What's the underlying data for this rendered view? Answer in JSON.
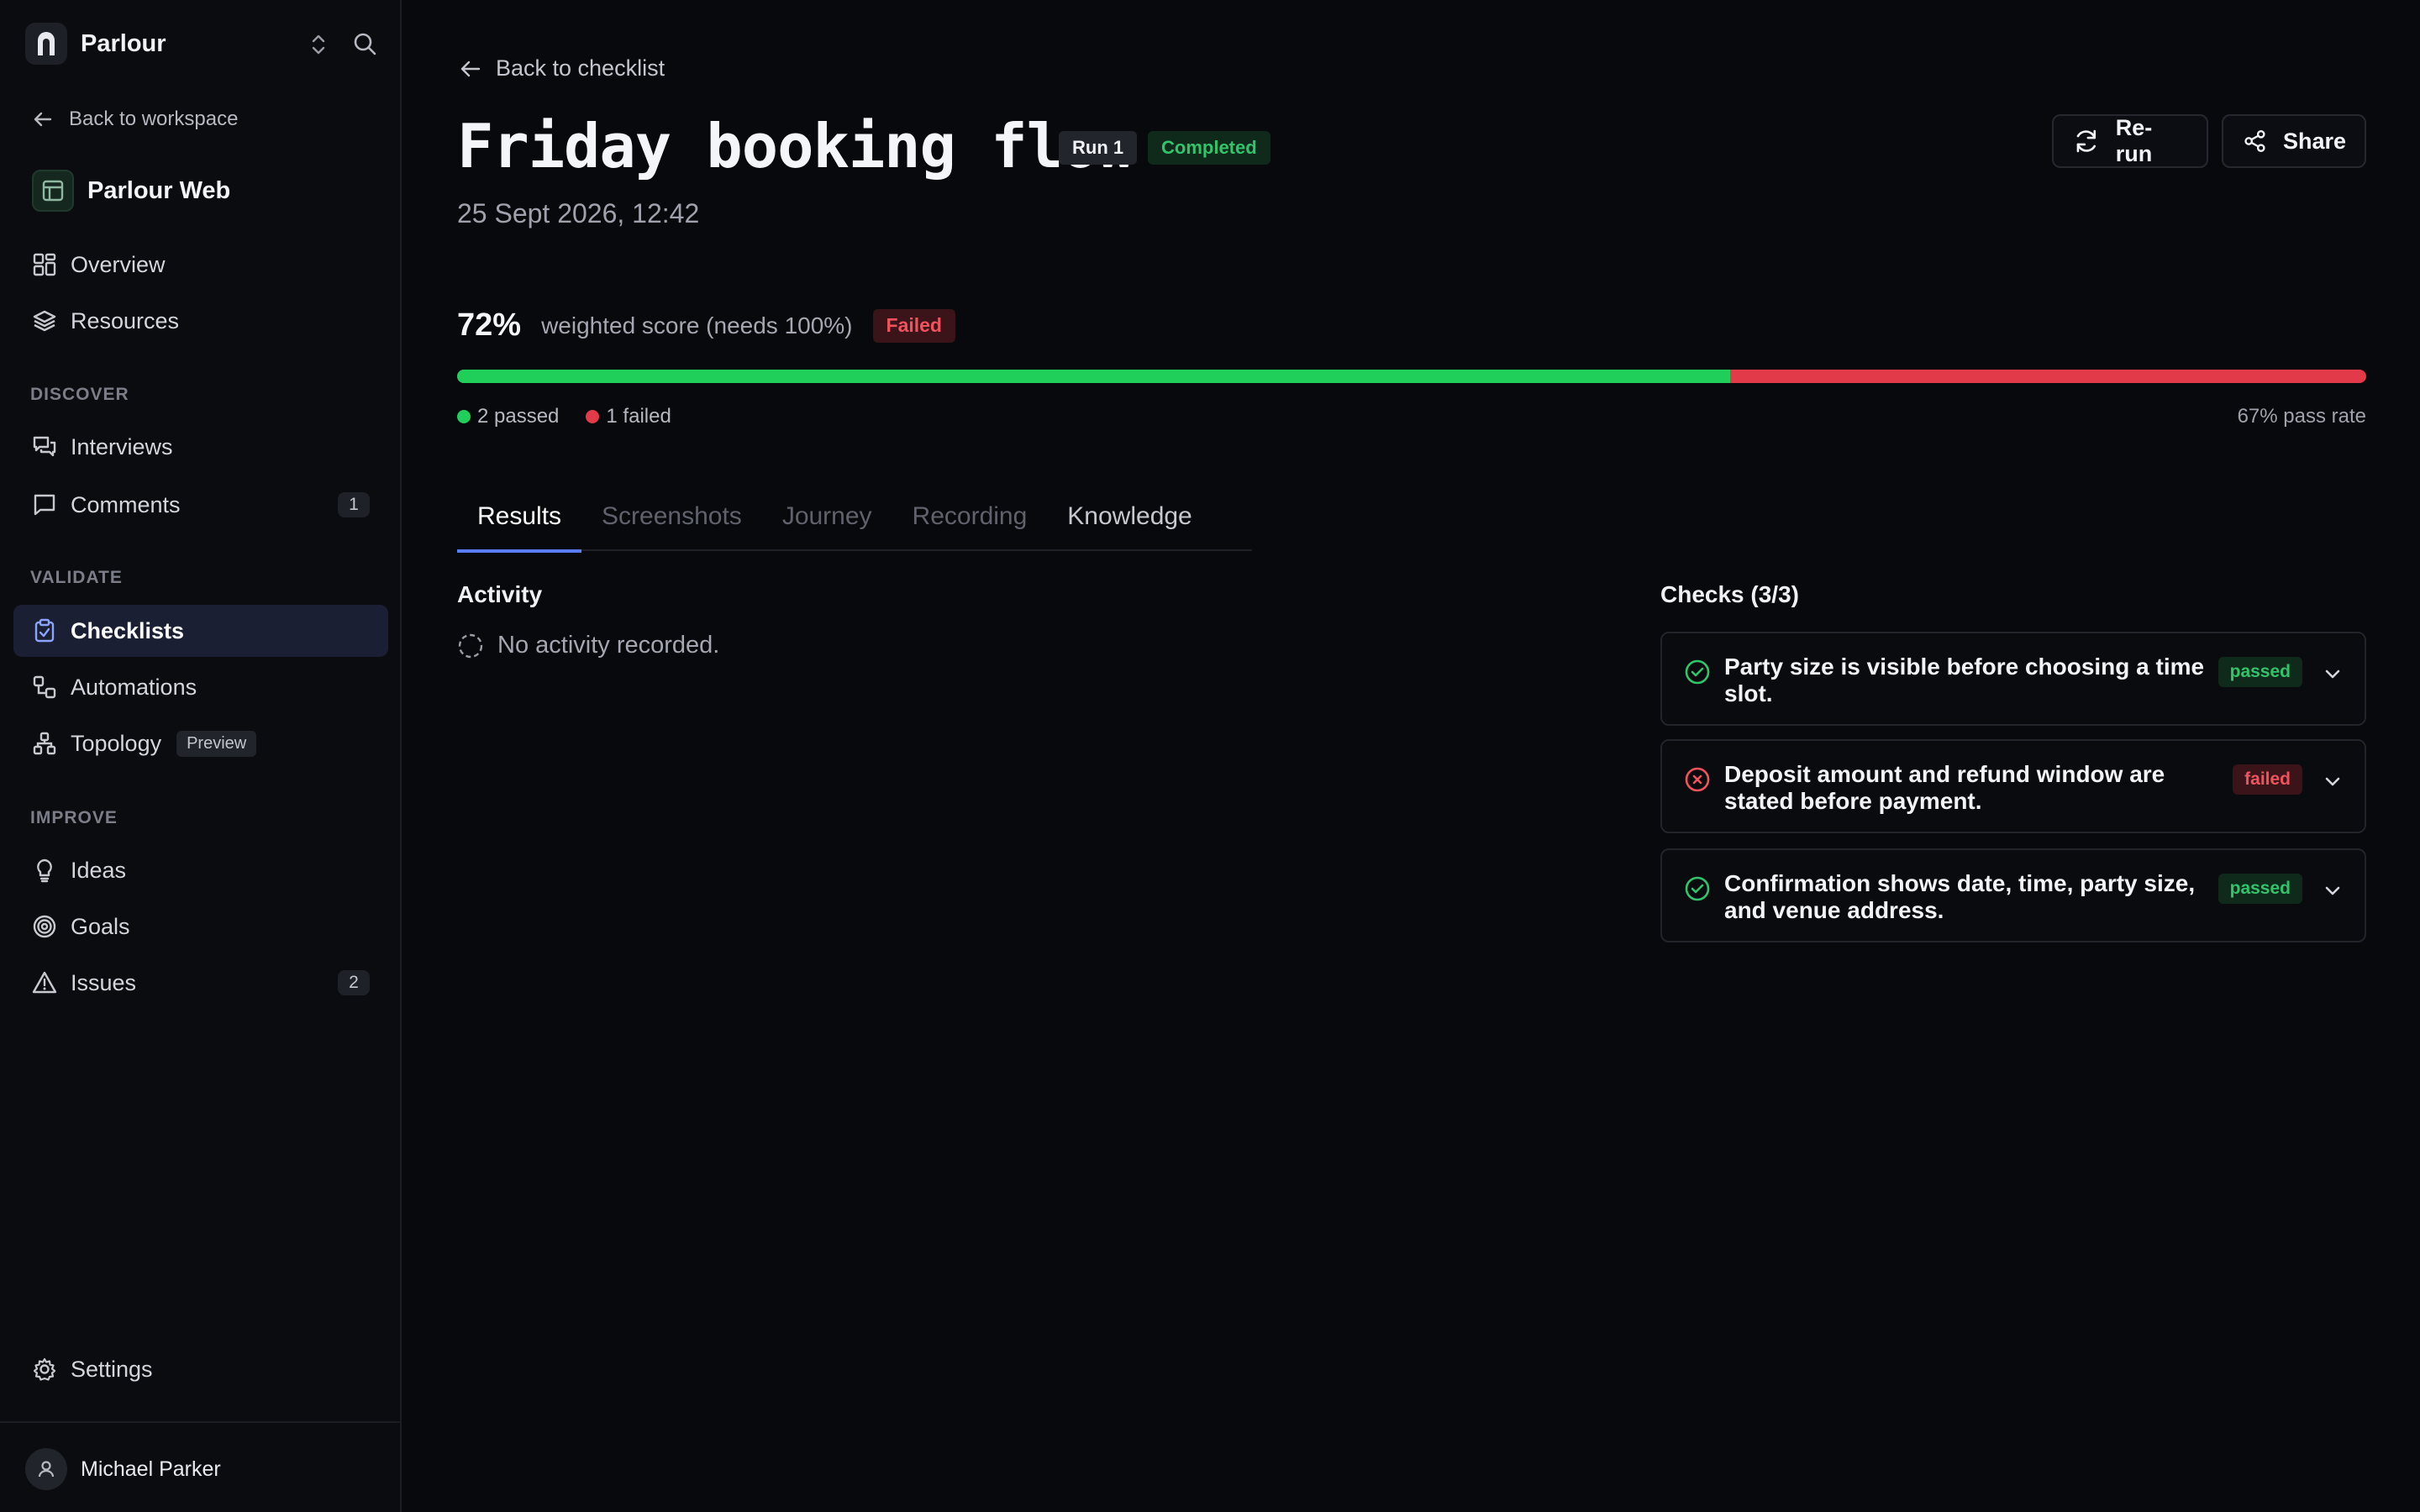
{
  "app": {
    "name": "Parlour",
    "back_to_workspace": "Back to workspace",
    "project_name": "Parlour Web"
  },
  "sidebar": {
    "top_items": [
      {
        "label": "Overview",
        "icon": "grid-icon"
      },
      {
        "label": "Resources",
        "icon": "layers-icon"
      }
    ],
    "sections": {
      "discover": "DISCOVER",
      "validate": "VALIDATE",
      "improve": "IMPROVE"
    },
    "discover_items": [
      {
        "label": "Interviews",
        "icon": "chat-icon"
      },
      {
        "label": "Comments",
        "icon": "comment-icon",
        "count": "1"
      }
    ],
    "validate_items": [
      {
        "label": "Checklists",
        "icon": "clipboard-check-icon",
        "active": true
      },
      {
        "label": "Automations",
        "icon": "automation-icon"
      },
      {
        "label": "Topology",
        "icon": "topology-icon",
        "badge": "Preview"
      }
    ],
    "improve_items": [
      {
        "label": "Ideas",
        "icon": "lightbulb-icon"
      },
      {
        "label": "Goals",
        "icon": "target-icon"
      },
      {
        "label": "Issues",
        "icon": "warning-icon",
        "count": "2"
      }
    ],
    "settings": "Settings",
    "user": "Michael Parker"
  },
  "header": {
    "back_link": "Back to checklist",
    "title": "Friday booking flow",
    "run_badge": "Run 1",
    "status_badge": "Completed",
    "subtitle": "25 Sept 2026, 12:42",
    "rerun_label": "Re-run",
    "share_label": "Share"
  },
  "score": {
    "percent": "72%",
    "description": "weighted score (needs 100%)",
    "status": "Failed",
    "pass_fraction": 0.667,
    "passed_label": "2 passed",
    "failed_label": "1 failed",
    "pass_rate": "67% pass rate"
  },
  "tabs": [
    {
      "label": "Results",
      "state": "active"
    },
    {
      "label": "Screenshots",
      "state": "muted"
    },
    {
      "label": "Journey",
      "state": "muted"
    },
    {
      "label": "Recording",
      "state": "muted"
    },
    {
      "label": "Knowledge",
      "state": "strong"
    }
  ],
  "activity": {
    "title": "Activity",
    "empty_text": "No activity recorded."
  },
  "checks": {
    "title": "Checks (3/3)",
    "items": [
      {
        "text": "Party size is visible before choosing a time slot.",
        "result": "passed"
      },
      {
        "text": "Deposit amount and refund window are stated before payment.",
        "result": "failed"
      },
      {
        "text": "Confirmation shows date, time, party size, and venue address.",
        "result": "passed"
      }
    ]
  },
  "colors": {
    "pass": "#1fcf5a",
    "fail": "#e23a48",
    "accent": "#5b7cf5"
  }
}
